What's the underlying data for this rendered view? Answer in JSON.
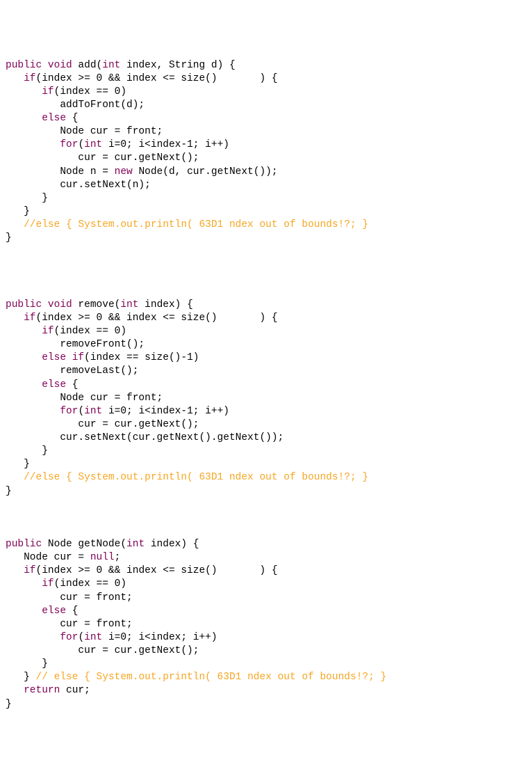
{
  "code": {
    "lines": [
      {
        "segments": [
          {
            "t": "public",
            "c": "kw"
          },
          {
            "t": " "
          },
          {
            "t": "void",
            "c": "kw"
          },
          {
            "t": " add("
          },
          {
            "t": "int",
            "c": "type"
          },
          {
            "t": " index, String d) {"
          }
        ]
      },
      {
        "segments": [
          {
            "t": "   "
          },
          {
            "t": "if",
            "c": "kw"
          },
          {
            "t": "(index >= 0 && index <= size()       ) {"
          }
        ]
      },
      {
        "segments": [
          {
            "t": "      "
          },
          {
            "t": "if",
            "c": "kw"
          },
          {
            "t": "(index == 0)"
          }
        ]
      },
      {
        "segments": [
          {
            "t": "         addToFront(d);"
          }
        ]
      },
      {
        "segments": [
          {
            "t": "      "
          },
          {
            "t": "else",
            "c": "kw"
          },
          {
            "t": " {"
          }
        ]
      },
      {
        "segments": [
          {
            "t": "         Node cur = front;"
          }
        ]
      },
      {
        "segments": [
          {
            "t": "         "
          },
          {
            "t": "for",
            "c": "kw"
          },
          {
            "t": "("
          },
          {
            "t": "int",
            "c": "type"
          },
          {
            "t": " i=0; i<index-1; i++)"
          }
        ]
      },
      {
        "segments": [
          {
            "t": "            cur = cur.getNext();"
          }
        ]
      },
      {
        "segments": [
          {
            "t": "         Node n = "
          },
          {
            "t": "new",
            "c": "kw"
          },
          {
            "t": " Node(d, cur.getNext());"
          }
        ]
      },
      {
        "segments": [
          {
            "t": "         cur.setNext(n);"
          }
        ]
      },
      {
        "segments": [
          {
            "t": "      }"
          }
        ]
      },
      {
        "segments": [
          {
            "t": "   }"
          }
        ]
      },
      {
        "segments": [
          {
            "t": "   "
          },
          {
            "t": "//else { System.out.println( 63D1 ndex out of bounds!?; }",
            "c": "comment"
          }
        ]
      },
      {
        "segments": [
          {
            "t": "}"
          }
        ]
      },
      {
        "segments": [
          {
            "t": ""
          }
        ]
      },
      {
        "segments": [
          {
            "t": ""
          }
        ]
      },
      {
        "segments": [
          {
            "t": ""
          }
        ]
      },
      {
        "segments": [
          {
            "t": ""
          }
        ]
      },
      {
        "segments": [
          {
            "t": "public",
            "c": "kw"
          },
          {
            "t": " "
          },
          {
            "t": "void",
            "c": "kw"
          },
          {
            "t": " remove("
          },
          {
            "t": "int",
            "c": "type"
          },
          {
            "t": " index) {"
          }
        ]
      },
      {
        "segments": [
          {
            "t": "   "
          },
          {
            "t": "if",
            "c": "kw"
          },
          {
            "t": "(index >= 0 && index <= size()       ) {"
          }
        ]
      },
      {
        "segments": [
          {
            "t": "      "
          },
          {
            "t": "if",
            "c": "kw"
          },
          {
            "t": "(index == 0)"
          }
        ]
      },
      {
        "segments": [
          {
            "t": "         removeFront();"
          }
        ]
      },
      {
        "segments": [
          {
            "t": "      "
          },
          {
            "t": "else",
            "c": "kw"
          },
          {
            "t": " "
          },
          {
            "t": "if",
            "c": "kw"
          },
          {
            "t": "(index == size()-1)"
          }
        ]
      },
      {
        "segments": [
          {
            "t": "         removeLast();"
          }
        ]
      },
      {
        "segments": [
          {
            "t": "      "
          },
          {
            "t": "else",
            "c": "kw"
          },
          {
            "t": " {"
          }
        ]
      },
      {
        "segments": [
          {
            "t": "         Node cur = front;"
          }
        ]
      },
      {
        "segments": [
          {
            "t": "         "
          },
          {
            "t": "for",
            "c": "kw"
          },
          {
            "t": "("
          },
          {
            "t": "int",
            "c": "type"
          },
          {
            "t": " i=0; i<index-1; i++)"
          }
        ]
      },
      {
        "segments": [
          {
            "t": "            cur = cur.getNext();"
          }
        ]
      },
      {
        "segments": [
          {
            "t": "         cur.setNext(cur.getNext().getNext());"
          }
        ]
      },
      {
        "segments": [
          {
            "t": "      }"
          }
        ]
      },
      {
        "segments": [
          {
            "t": "   }"
          }
        ]
      },
      {
        "segments": [
          {
            "t": "   "
          },
          {
            "t": "//else { System.out.println( 63D1 ndex out of bounds!?; }",
            "c": "comment"
          }
        ]
      },
      {
        "segments": [
          {
            "t": "}"
          }
        ]
      },
      {
        "segments": [
          {
            "t": ""
          }
        ]
      },
      {
        "segments": [
          {
            "t": ""
          }
        ]
      },
      {
        "segments": [
          {
            "t": ""
          }
        ]
      },
      {
        "segments": [
          {
            "t": "public",
            "c": "kw"
          },
          {
            "t": " Node getNode("
          },
          {
            "t": "int",
            "c": "type"
          },
          {
            "t": " index) {"
          }
        ]
      },
      {
        "segments": [
          {
            "t": "   Node cur = "
          },
          {
            "t": "null",
            "c": "kw"
          },
          {
            "t": ";"
          }
        ]
      },
      {
        "segments": [
          {
            "t": "   "
          },
          {
            "t": "if",
            "c": "kw"
          },
          {
            "t": "(index >= 0 && index <= size()       ) {"
          }
        ]
      },
      {
        "segments": [
          {
            "t": "      "
          },
          {
            "t": "if",
            "c": "kw"
          },
          {
            "t": "(index == 0)"
          }
        ]
      },
      {
        "segments": [
          {
            "t": "         cur = front;"
          }
        ]
      },
      {
        "segments": [
          {
            "t": "      "
          },
          {
            "t": "else",
            "c": "kw"
          },
          {
            "t": " {"
          }
        ]
      },
      {
        "segments": [
          {
            "t": "         cur = front;"
          }
        ]
      },
      {
        "segments": [
          {
            "t": "         "
          },
          {
            "t": "for",
            "c": "kw"
          },
          {
            "t": "("
          },
          {
            "t": "int",
            "c": "type"
          },
          {
            "t": " i=0; i<index; i++)"
          }
        ]
      },
      {
        "segments": [
          {
            "t": "            cur = cur.getNext();"
          }
        ]
      },
      {
        "segments": [
          {
            "t": "      }"
          }
        ]
      },
      {
        "segments": [
          {
            "t": "   } "
          },
          {
            "t": "// else { System.out.println( 63D1 ndex out of bounds!?; }",
            "c": "comment"
          }
        ]
      },
      {
        "segments": [
          {
            "t": "   "
          },
          {
            "t": "return",
            "c": "kw"
          },
          {
            "t": " cur;"
          }
        ]
      },
      {
        "segments": [
          {
            "t": "}"
          }
        ]
      }
    ]
  }
}
